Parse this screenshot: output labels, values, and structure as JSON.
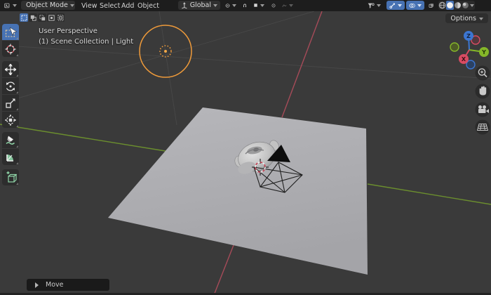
{
  "header": {
    "editor_icon": "editor-type-3d-viewport-icon",
    "mode": {
      "icon": "object-mode-icon",
      "label": "Object Mode"
    },
    "menus": [
      {
        "label": "View"
      },
      {
        "label": "Select"
      },
      {
        "label": "Add"
      },
      {
        "label": "Object"
      }
    ],
    "orientation": {
      "icon": "transform-orientation-icon",
      "label": "Global"
    },
    "pivot_icon": "pivot-point-icon",
    "snap_icon": "snap-magnet-icon",
    "snap_target_icon": "snap-target-icon",
    "proportional_icon": "proportional-editing-icon",
    "falloff_icon": "proportional-falloff-icon",
    "visibility_icon": "object-type-visibility-icon",
    "gizmo_icon": "show-gizmo-icon",
    "overlays_icon": "show-overlays-icon",
    "xray_icon": "toggle-xray-icon",
    "shading": [
      "wireframe",
      "solid",
      "material-preview",
      "rendered"
    ],
    "shading_active": "solid"
  },
  "tool_settings": {
    "select_modes": [
      "new",
      "extend",
      "subtract",
      "invert",
      "intersect"
    ],
    "select_mode_active": "new",
    "options_label": "Options"
  },
  "toolbar": {
    "tools": [
      "select-box",
      "cursor",
      "move",
      "rotate",
      "scale",
      "transform",
      "annotate",
      "measure",
      "add-cube"
    ],
    "active_tool": "select-box"
  },
  "viewport": {
    "perspective_label": "User Perspective",
    "collection_label": "(1) Scene Collection | Light",
    "operator_label": "Move",
    "gizmo": {
      "x": "X",
      "y": "Y",
      "z": "Z"
    },
    "nav_icons": [
      "zoom-icon",
      "pan-hand-icon",
      "camera-view-icon",
      "perspective-grid-icon"
    ],
    "objects": [
      "point-light",
      "suzanne-monkey",
      "camera",
      "ground-plane",
      "3d-cursor"
    ]
  },
  "colors": {
    "accent_blue": "#4772b3",
    "axis_x_red": "#a64b59",
    "axis_y_green": "#6b8e2e",
    "gizmo_x": "#d94b62",
    "gizmo_y": "#85b729",
    "gizmo_z": "#3c76d2",
    "light_orange": "#ee9a3a",
    "plane_gray": "#adadb1",
    "viewport_bg": "#3a3a3a",
    "header_bg": "#1d1d1d"
  }
}
